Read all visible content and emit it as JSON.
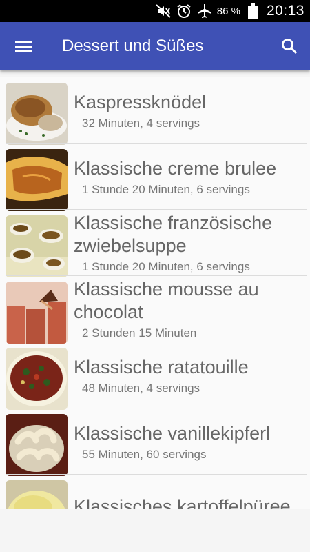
{
  "statusbar": {
    "battery_percent": "86 %",
    "time": "20:13",
    "icons": [
      "mute-icon",
      "alarm-icon",
      "airplane-icon",
      "battery-icon"
    ]
  },
  "appbar": {
    "title": "Dessert und Süßes",
    "menu_icon": "menu-icon",
    "search_icon": "search-icon"
  },
  "recipes": [
    {
      "name": "Kaspressknödel",
      "subtitle": "32 Minuten, 4 servings"
    },
    {
      "name": "Klassische creme brulee",
      "subtitle": "1 Stunde 20 Minuten, 6 servings"
    },
    {
      "name": "Klassische französische zwiebelsuppe",
      "subtitle": "1 Stunde 20 Minuten, 6 servings"
    },
    {
      "name": "Klassische mousse au chocolat",
      "subtitle": "2 Stunden 15 Minuten"
    },
    {
      "name": "Klassische ratatouille",
      "subtitle": "48 Minuten, 4 servings"
    },
    {
      "name": "Klassische vanillekipferl",
      "subtitle": "55 Minuten, 60 servings"
    },
    {
      "name": "Klassisches kartoffelpüree",
      "subtitle": ""
    }
  ]
}
